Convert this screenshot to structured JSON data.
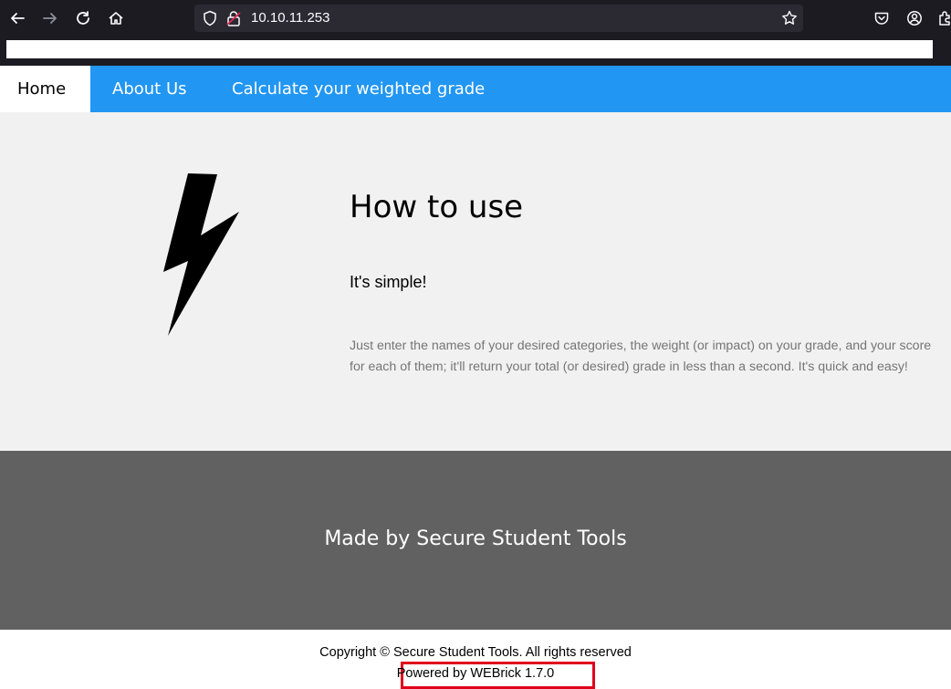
{
  "browser": {
    "url": "10.10.11.253",
    "icons": [
      "back-arrow-icon",
      "forward-arrow-icon",
      "reload-icon",
      "home-icon",
      "shield-icon",
      "lock-icon",
      "star-icon",
      "pocket-icon",
      "account-icon",
      "extensions-icon"
    ]
  },
  "nav": {
    "items": [
      {
        "label": "Home",
        "active": true
      },
      {
        "label": "About Us",
        "active": false
      },
      {
        "label": "Calculate your weighted grade",
        "active": false
      }
    ]
  },
  "main": {
    "icon": "lightning-bolt-icon",
    "title": "How to use",
    "subtitle": "It's simple!",
    "description": "Just enter the names of your desired categories, the weight (or impact) on your grade, and your score for each of them; it'll return your total (or desired) grade in less than a second. It's quick and easy!"
  },
  "footer": {
    "made_by": "Made by Secure Student Tools",
    "copyright": "Copyright © Secure Student Tools. All rights reserved",
    "powered_by": "Powered by WEBrick 1.7.0"
  },
  "colors": {
    "nav_bg": "#2196f3",
    "main_bg": "#f1f1f1",
    "footer_band_bg": "#616161",
    "highlight_box": "#e0001b",
    "browser_chrome": "#1c1b22"
  }
}
